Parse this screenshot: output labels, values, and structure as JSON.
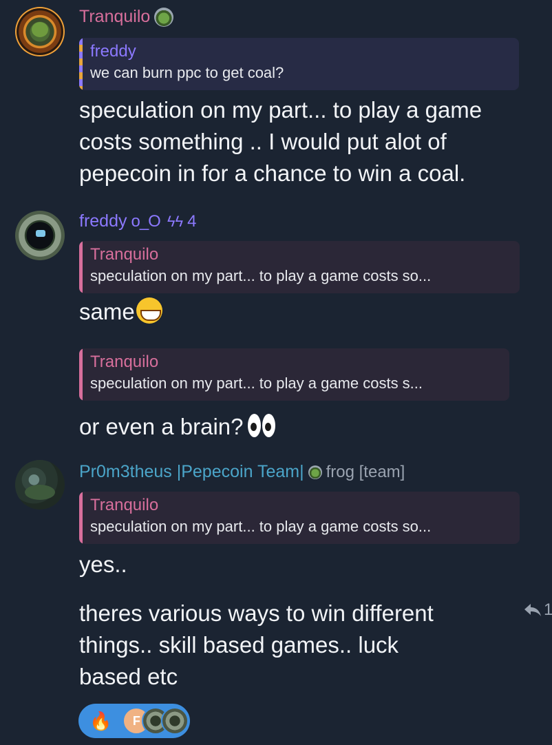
{
  "messages": {
    "tranquilo": {
      "sender": "Tranquilo",
      "reply_name": "freddy",
      "reply_text": "we can burn ppc to get coal?",
      "text_lines": [
        "speculation on my part... to play a game",
        "costs something .. I would put alot of",
        "pepecoin in for a chance to win a coal."
      ]
    },
    "freddy": {
      "sender": "freddy",
      "status": "o_O",
      "boost_count": "4",
      "reply1_name": "Tranquilo",
      "reply1_text": "speculation on my part... to play a game costs so...",
      "text1": "same",
      "reply2_name": "Tranquilo",
      "reply2_text": "speculation on my part... to play a game costs s...",
      "text2": "or even a brain?"
    },
    "prometheus": {
      "sender": "Pr0m3theus |Pepecoin Team|",
      "tag": "frog [team]",
      "reply_name": "Tranquilo",
      "reply_text": "speculation on my part... to play a game costs so...",
      "text1": "yes..",
      "text2_lines": [
        "theres various ways to win different",
        "things.. skill based games.. luck",
        "based etc"
      ],
      "reply_count": "1"
    }
  },
  "reactions": {
    "emoji": "🔥",
    "avatar_initial": "F"
  },
  "icons": {
    "frog_badge": "frog-badge-icon",
    "boost": "boost-icon",
    "reply": "reply-arrow-icon",
    "grin": "grinning-face-emoji",
    "eyes": "eyes-emoji"
  },
  "colors": {
    "background": "#1b2432",
    "tranquilo": "#d86f9c",
    "freddy": "#8c79ff",
    "prometheus": "#4ba5c9",
    "reaction_pill": "#3d8fe0"
  }
}
